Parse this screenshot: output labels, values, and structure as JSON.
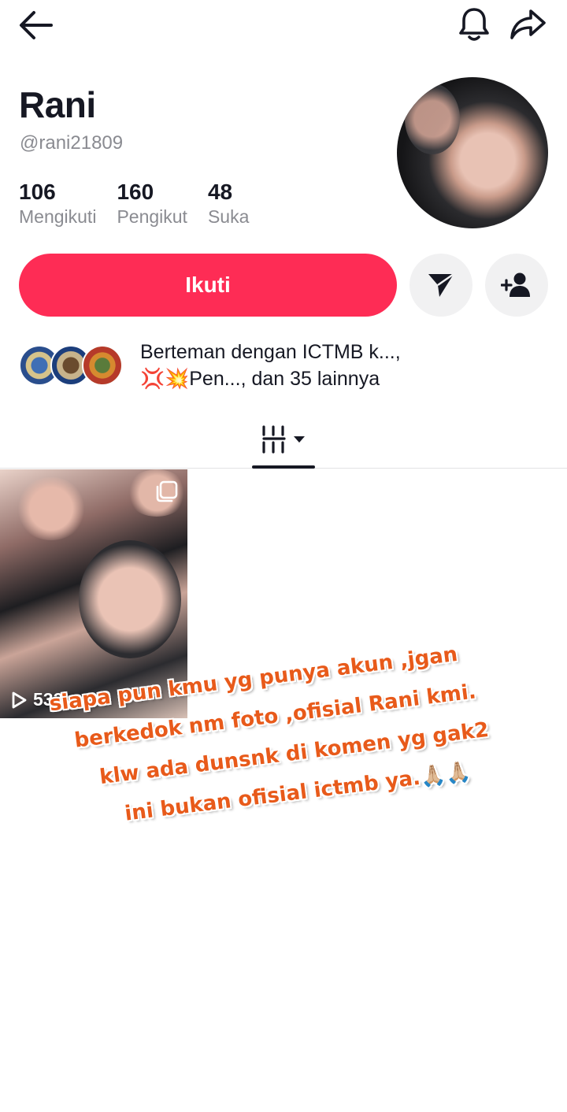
{
  "profile": {
    "name": "Rani",
    "handle": "@rani21809",
    "stats": [
      {
        "value": "106",
        "label": "Mengikuti"
      },
      {
        "value": "160",
        "label": "Pengikut"
      },
      {
        "value": "48",
        "label": "Suka"
      }
    ]
  },
  "actions": {
    "follow_label": "Ikuti"
  },
  "mutual": {
    "line1": "Berteman dengan ICTMB k...,",
    "line2": "💢💥Pen..., dan 35 lainnya"
  },
  "videos": [
    {
      "play_count": "533"
    }
  ],
  "overlay_text": {
    "line1": "siapa pun kmu yg punya akun ,jgan",
    "line2": "berkedok nm foto ,ofisial Rani kmi.",
    "line3": "klw ada dunsnk di komen yg gak2",
    "line4": "ini bukan ofisial ictmb ya.🙏🏼🙏🏼"
  },
  "colors": {
    "accent": "#fe2c55",
    "overlay_text": "#e85a1a",
    "secondary_text": "#8a8b91"
  },
  "icons": [
    "back-arrow-icon",
    "bell-icon",
    "share-icon",
    "send-icon",
    "add-friend-icon",
    "grid-icon",
    "dropdown-caret-icon",
    "multi-photo-icon",
    "play-icon"
  ]
}
